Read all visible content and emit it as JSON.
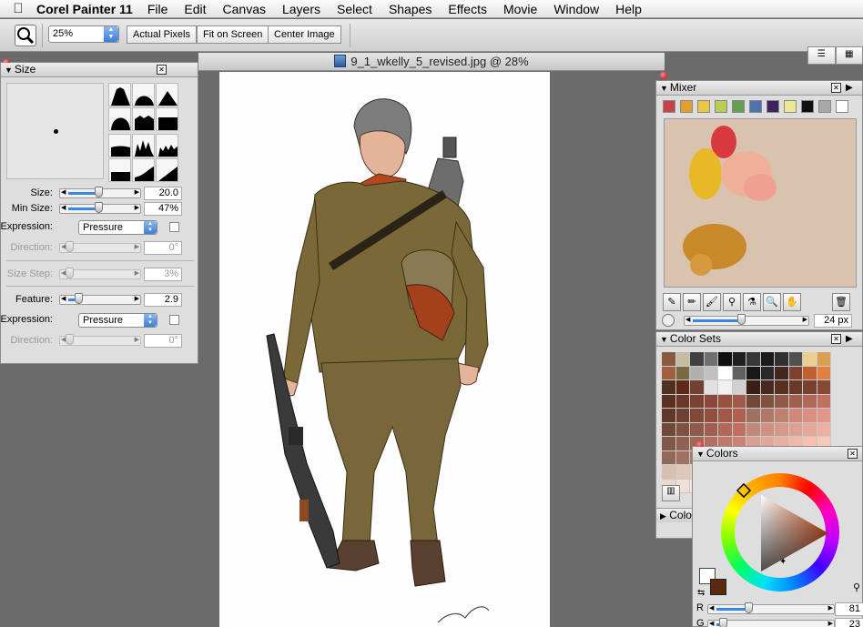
{
  "menubar": {
    "app_name": "Corel Painter 11",
    "items": [
      "File",
      "Edit",
      "Canvas",
      "Layers",
      "Select",
      "Shapes",
      "Effects",
      "Movie",
      "Window",
      "Help"
    ]
  },
  "toolbar": {
    "zoom_value": "25%",
    "actual_pixels": "Actual Pixels",
    "fit_on_screen": "Fit on Screen",
    "center_image": "Center Image"
  },
  "document": {
    "title": "9_1_wkelly_5_revised.jpg @ 28%"
  },
  "size_panel": {
    "title": "Size",
    "size_label": "Size:",
    "size_value": "20.0",
    "min_size_label": "Min Size:",
    "min_size_value": "47%",
    "expression_label": "Expression:",
    "expression_value": "Pressure",
    "direction_label": "Direction:",
    "direction_value": "0°",
    "size_step_label": "Size Step:",
    "size_step_value": "3%",
    "feature_label": "Feature:",
    "feature_value": "2.9",
    "expression2_label": "Expression:",
    "expression2_value": "Pressure",
    "direction2_label": "Direction:",
    "direction2_value": "0°"
  },
  "mixer_panel": {
    "title": "Mixer",
    "brush_size": "24 px",
    "swatches": [
      "#c8404a",
      "#e0a030",
      "#e8c840",
      "#b8cc50",
      "#60a050",
      "#5070b0",
      "#402060",
      "#f0e890",
      "#101010",
      "#a8a8a8",
      "#ffffff"
    ]
  },
  "colorsets_panel": {
    "title": "Color Sets",
    "footer_label": "Colo"
  },
  "colors_panel": {
    "title": "Colors",
    "r_label": "R",
    "r_value": "81",
    "g_label": "G",
    "g_value": "23",
    "primary_color": "#ffffff",
    "secondary_color": "#5a2a0c"
  }
}
